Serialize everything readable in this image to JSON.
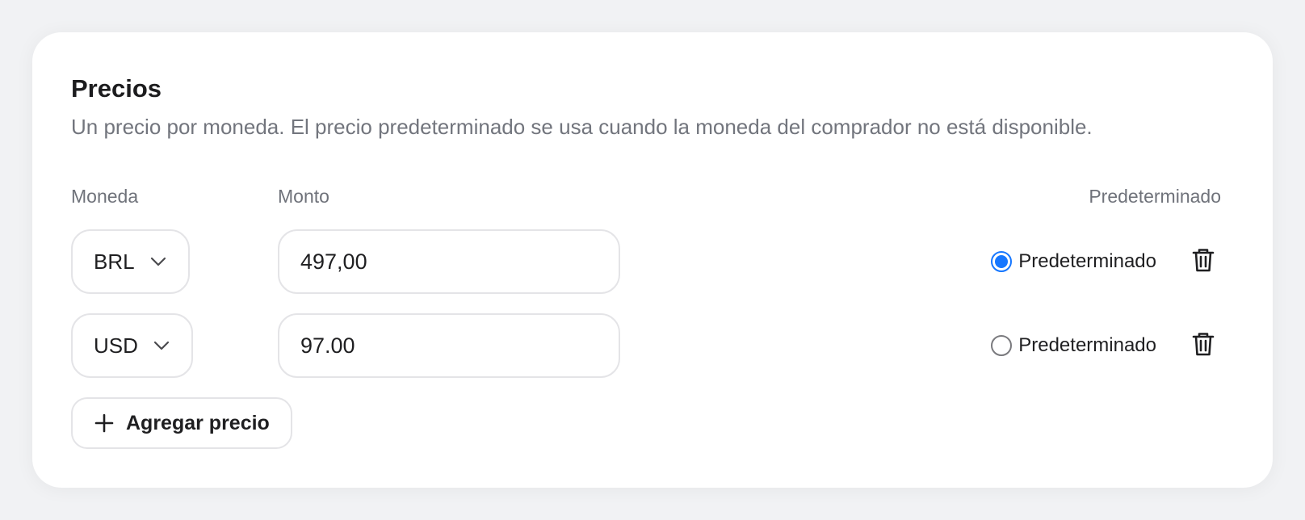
{
  "section": {
    "title": "Precios",
    "subtitle": "Un precio por moneda. El precio predeterminado se usa cuando la moneda del comprador no está disponible."
  },
  "columns": {
    "currency": "Moneda",
    "amount": "Monto",
    "default": "Predeterminado"
  },
  "rows": [
    {
      "currency": "BRL",
      "amount": "497,00",
      "default_label": "Predeterminado",
      "is_default": true
    },
    {
      "currency": "USD",
      "amount": "97.00",
      "default_label": "Predeterminado",
      "is_default": false
    }
  ],
  "actions": {
    "add_price": "Agregar precio"
  },
  "icons": {
    "select": "chevron-down-icon",
    "delete": "trash-icon",
    "add": "plus-icon"
  },
  "colors": {
    "accent": "#1677ff",
    "muted_text": "#72757d",
    "border": "#e4e4e7"
  }
}
